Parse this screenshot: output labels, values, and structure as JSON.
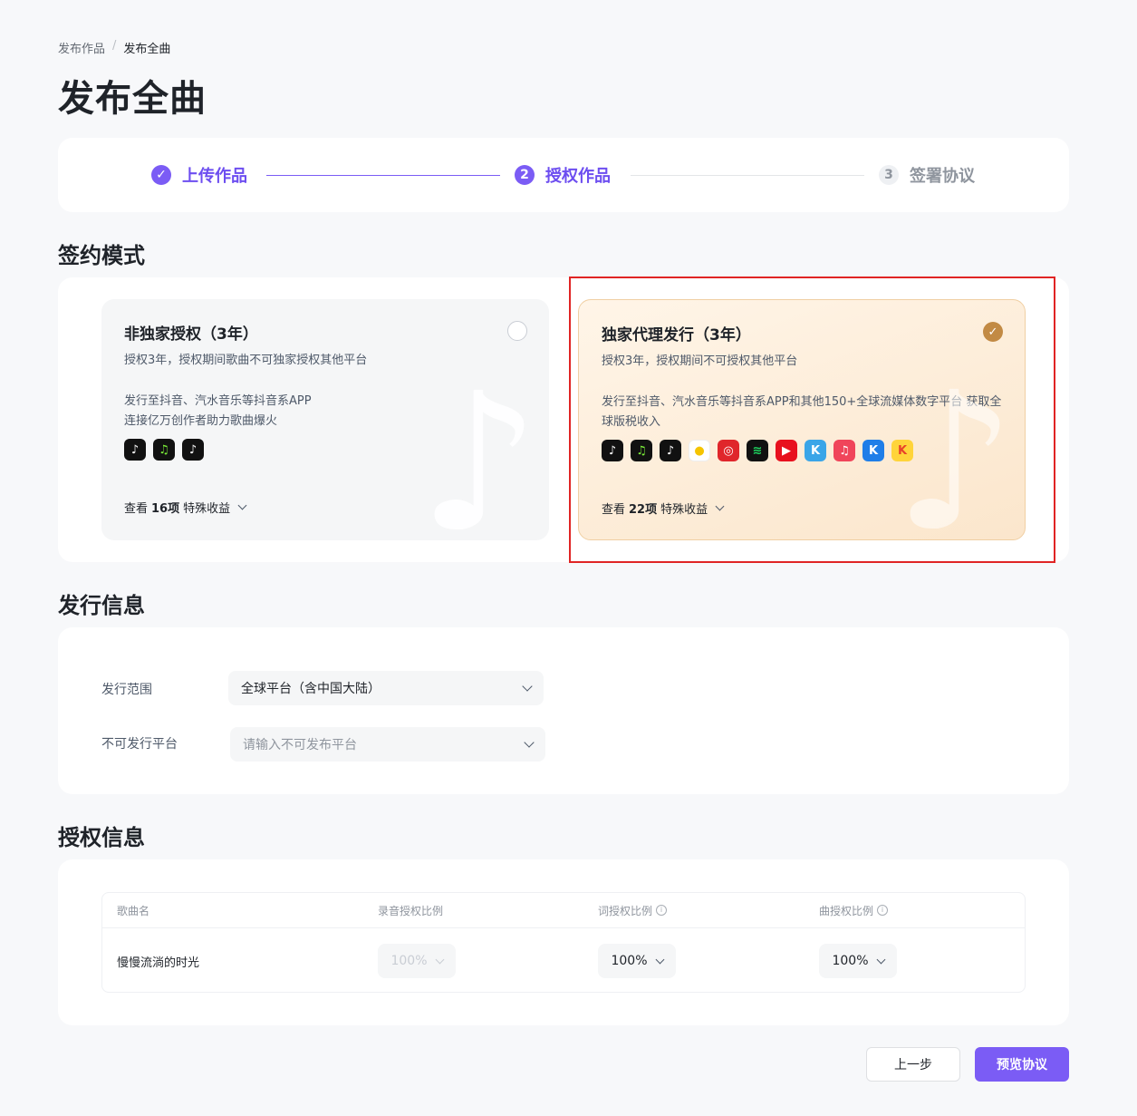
{
  "breadcrumb": {
    "parent": "发布作品",
    "separator": "/",
    "current": "发布全曲"
  },
  "page_title": "发布全曲",
  "steps": [
    {
      "index": "✓",
      "label": "上传作品",
      "state": "done"
    },
    {
      "index": "2",
      "label": "授权作品",
      "state": "active"
    },
    {
      "index": "3",
      "label": "签署协议",
      "state": "todo"
    }
  ],
  "sections": {
    "mode": "签约模式",
    "release": "发行信息",
    "auth": "授权信息"
  },
  "options": {
    "non_exclusive": {
      "title": "非独家授权（3年）",
      "desc": "授权3年，授权期间歌曲不可独家授权其他平台",
      "body_line1": "发行至抖音、汽水音乐等抖音系APP",
      "body_line2": "连接亿万创作者助力歌曲爆火",
      "view_prefix": "查看",
      "view_count": "16项",
      "view_suffix": "特殊收益",
      "selected": false,
      "icons": [
        "douyin-icon",
        "qishui-icon",
        "douyin-lite-icon"
      ]
    },
    "exclusive": {
      "title": "独家代理发行（3年）",
      "desc": "授权3年，授权期间不可授权其他平台",
      "body_line1": "发行至抖音、汽水音乐等抖音系APP和其他150+全球流媒体数字平台 获取全球版税收入",
      "view_prefix": "查看",
      "view_count": "22项",
      "view_suffix": "特殊收益",
      "selected": true,
      "icons": [
        "douyin-icon",
        "qishui-icon",
        "douyin-lite-icon",
        "qq-music-icon",
        "netease-music-icon",
        "spotify-icon",
        "youtube-music-icon",
        "kugou-icon",
        "apple-music-icon",
        "kuwo-icon",
        "kuaishou-icon"
      ]
    }
  },
  "release": {
    "scope_label": "发行范围",
    "scope_value": "全球平台（含中国大陆）",
    "excluded_label": "不可发行平台",
    "excluded_placeholder": "请输入不可发布平台"
  },
  "auth_table": {
    "headers": [
      "歌曲名",
      "录音授权比例",
      "词授权比例",
      "曲授权比例"
    ],
    "rows": [
      {
        "song": "慢慢流淌的时光",
        "recording": "100%",
        "lyrics": "100%",
        "music": "100%"
      }
    ]
  },
  "buttons": {
    "prev": "上一步",
    "next": "预览协议"
  },
  "colors": {
    "accent": "#7b5cf5",
    "gold": "#c28a44",
    "highlight": "#e02424"
  }
}
